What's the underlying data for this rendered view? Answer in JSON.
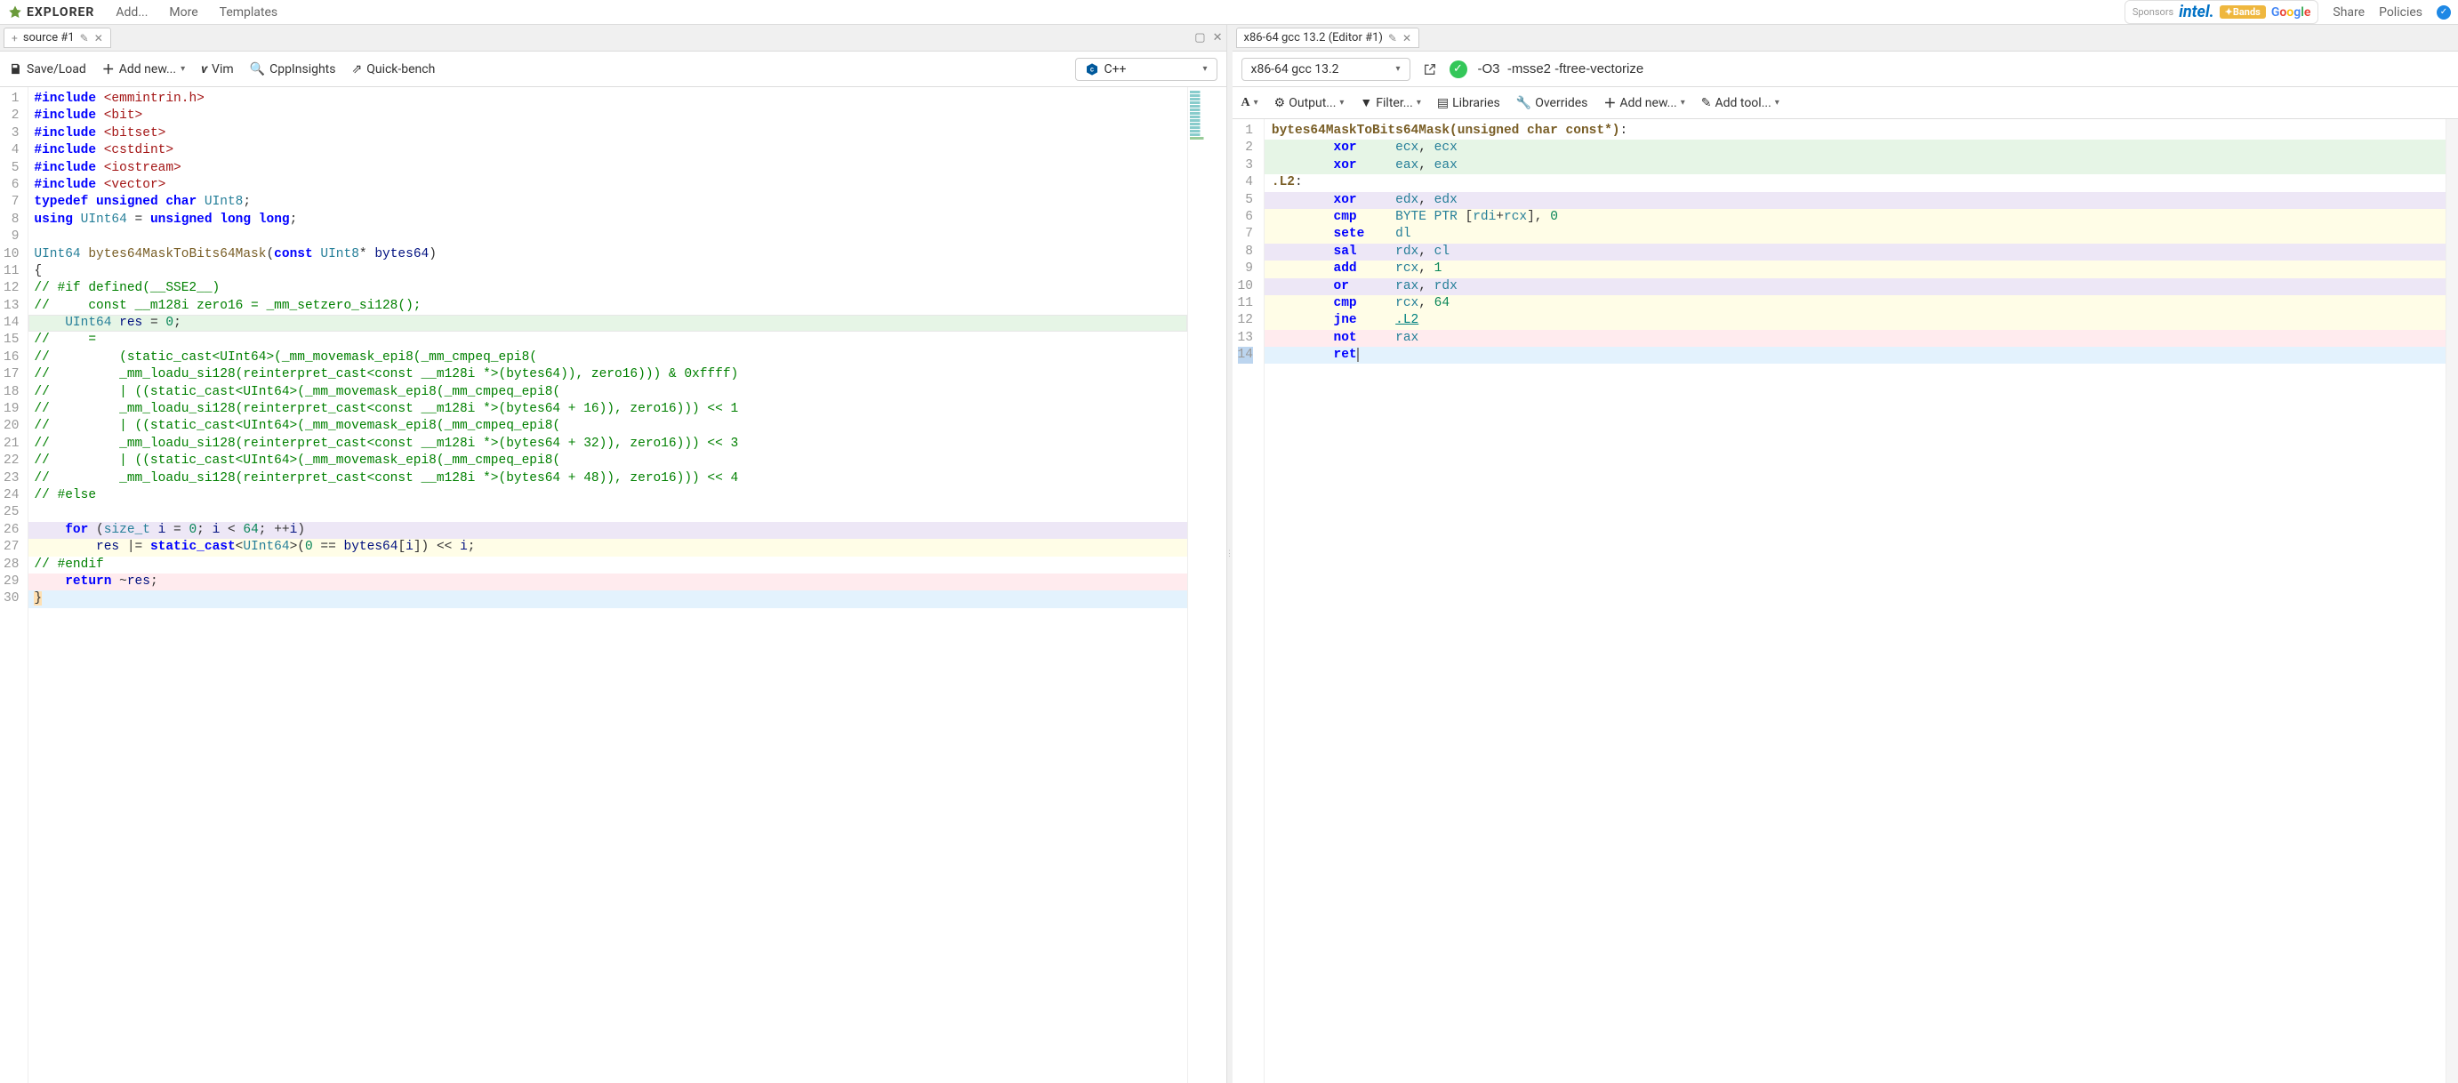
{
  "brand": "EXPLORER",
  "top_links": [
    "Add...",
    "More",
    "Templates"
  ],
  "top_right": {
    "sponsors_label": "Sponsors",
    "share": "Share",
    "policies": "Policies"
  },
  "left": {
    "tab_label": "source #1",
    "toolbar": {
      "save": "Save/Load",
      "addnew": "Add new...",
      "vim": "Vim",
      "cpp": "CppInsights",
      "quick": "Quick-bench"
    },
    "language": "C++",
    "lines": [
      {
        "n": 1,
        "bg": "",
        "html": "<span class='kw'>#include</span> <span class='inc'>&lt;emmintrin.h&gt;</span>"
      },
      {
        "n": 2,
        "bg": "",
        "html": "<span class='kw'>#include</span> <span class='inc'>&lt;bit&gt;</span>"
      },
      {
        "n": 3,
        "bg": "",
        "html": "<span class='kw'>#include</span> <span class='inc'>&lt;bitset&gt;</span>"
      },
      {
        "n": 4,
        "bg": "",
        "html": "<span class='kw'>#include</span> <span class='inc'>&lt;cstdint&gt;</span>"
      },
      {
        "n": 5,
        "bg": "",
        "html": "<span class='kw'>#include</span> <span class='inc'>&lt;iostream&gt;</span>"
      },
      {
        "n": 6,
        "bg": "",
        "html": "<span class='kw'>#include</span> <span class='inc'>&lt;vector&gt;</span>"
      },
      {
        "n": 7,
        "bg": "",
        "html": "<span class='kw'>typedef</span> <span class='kw'>unsigned</span> <span class='kw'>char</span> <span class='type'>UInt8</span>;"
      },
      {
        "n": 8,
        "bg": "",
        "html": "<span class='kw'>using</span> <span class='type'>UInt64</span> = <span class='kw'>unsigned</span> <span class='kw'>long</span> <span class='kw'>long</span>;"
      },
      {
        "n": 9,
        "bg": "",
        "html": ""
      },
      {
        "n": 10,
        "bg": "",
        "html": "<span class='type'>UInt64</span> <span class='fn'>bytes64MaskToBits64Mask</span>(<span class='kw'>const</span> <span class='type'>UInt8</span>* <span class='var'>bytes64</span>)"
      },
      {
        "n": 11,
        "bg": "",
        "html": "{"
      },
      {
        "n": 12,
        "bg": "",
        "html": "<span class='com'>// #if defined(__SSE2__)</span>"
      },
      {
        "n": 13,
        "bg": "",
        "html": "<span class='com'>//     const __m128i zero16 = _mm_setzero_si128();</span>"
      },
      {
        "n": 14,
        "bg": "bg-green hl-current",
        "html": "    <span class='type'>UInt64</span> <span class='var'>res</span> = <span class='num'>0</span>;"
      },
      {
        "n": 15,
        "bg": "",
        "html": "<span class='com'>//     =</span>"
      },
      {
        "n": 16,
        "bg": "",
        "html": "<span class='com'>//         (static_cast&lt;UInt64&gt;(_mm_movemask_epi8(_mm_cmpeq_epi8(</span>"
      },
      {
        "n": 17,
        "bg": "",
        "html": "<span class='com'>//         _mm_loadu_si128(reinterpret_cast&lt;const __m128i *&gt;(bytes64)), zero16))) &amp; 0xffff)</span>"
      },
      {
        "n": 18,
        "bg": "",
        "html": "<span class='com'>//         | ((static_cast&lt;UInt64&gt;(_mm_movemask_epi8(_mm_cmpeq_epi8(</span>"
      },
      {
        "n": 19,
        "bg": "",
        "html": "<span class='com'>//         _mm_loadu_si128(reinterpret_cast&lt;const __m128i *&gt;(bytes64 + 16)), zero16))) &lt;&lt; 1</span>"
      },
      {
        "n": 20,
        "bg": "",
        "html": "<span class='com'>//         | ((static_cast&lt;UInt64&gt;(_mm_movemask_epi8(_mm_cmpeq_epi8(</span>"
      },
      {
        "n": 21,
        "bg": "",
        "html": "<span class='com'>//         _mm_loadu_si128(reinterpret_cast&lt;const __m128i *&gt;(bytes64 + 32)), zero16))) &lt;&lt; 3</span>"
      },
      {
        "n": 22,
        "bg": "",
        "html": "<span class='com'>//         | ((static_cast&lt;UInt64&gt;(_mm_movemask_epi8(_mm_cmpeq_epi8(</span>"
      },
      {
        "n": 23,
        "bg": "",
        "html": "<span class='com'>//         _mm_loadu_si128(reinterpret_cast&lt;const __m128i *&gt;(bytes64 + 48)), zero16))) &lt;&lt; 4</span>"
      },
      {
        "n": 24,
        "bg": "",
        "html": "<span class='com'>// #else</span>"
      },
      {
        "n": 25,
        "bg": "",
        "html": ""
      },
      {
        "n": 26,
        "bg": "bg-purple",
        "html": "    <span class='kw'>for</span> (<span class='type'>size_t</span> <span class='var'>i</span> = <span class='num'>0</span>; <span class='var'>i</span> &lt; <span class='num'>64</span>; ++<span class='var'>i</span>)"
      },
      {
        "n": 27,
        "bg": "bg-yellow",
        "html": "        <span class='var'>res</span> |= <span class='kw'>static_cast</span>&lt;<span class='type'>UInt64</span>&gt;(<span class='num'>0</span> == <span class='var'>bytes64</span>[<span class='var'>i</span>]) &lt;&lt; <span class='var'>i</span>;"
      },
      {
        "n": 28,
        "bg": "",
        "html": "<span class='com'>// #endif</span>"
      },
      {
        "n": 29,
        "bg": "bg-red",
        "html": "    <span class='kw'>return</span> ~<span class='var'>res</span>;"
      },
      {
        "n": 30,
        "bg": "bg-blue",
        "html": "<span style='background:#ffe0b2'>}</span>"
      }
    ]
  },
  "right": {
    "tab_label": "x86-64 gcc 13.2 (Editor #1)",
    "compiler": "x86-64 gcc 13.2",
    "flags": "-O3  -msse2 -ftree-vectorize",
    "toolbar": {
      "font": "A",
      "output": "Output...",
      "filter": "Filter...",
      "libraries": "Libraries",
      "overrides": "Overrides",
      "addnew": "Add new...",
      "addtool": "Add tool..."
    },
    "asm": [
      {
        "n": 1,
        "bg": "",
        "html": "<span class='alabel'>bytes64MaskToBits64Mask(unsigned char const*)</span>:"
      },
      {
        "n": 2,
        "bg": "bg-green",
        "html": "        <span class='akw'>xor</span>     <span class='areg'>ecx</span>, <span class='areg'>ecx</span>"
      },
      {
        "n": 3,
        "bg": "bg-green",
        "html": "        <span class='akw'>xor</span>     <span class='areg'>eax</span>, <span class='areg'>eax</span>"
      },
      {
        "n": 4,
        "bg": "",
        "html": "<span class='alabel'>.L2</span>:"
      },
      {
        "n": 5,
        "bg": "bg-purple",
        "html": "        <span class='akw'>xor</span>     <span class='areg'>edx</span>, <span class='areg'>edx</span>"
      },
      {
        "n": 6,
        "bg": "bg-yellow",
        "html": "        <span class='akw'>cmp</span>     <span class='adir'>BYTE</span> <span class='adir'>PTR</span> [<span class='areg'>rdi</span>+<span class='areg'>rcx</span>], <span class='anum'>0</span>"
      },
      {
        "n": 7,
        "bg": "bg-yellow",
        "html": "        <span class='akw'>sete</span>    <span class='areg'>dl</span>"
      },
      {
        "n": 8,
        "bg": "bg-purple",
        "html": "        <span class='akw'>sal</span>     <span class='areg'>rdx</span>, <span class='areg'>cl</span>"
      },
      {
        "n": 9,
        "bg": "bg-yellow",
        "html": "        <span class='akw'>add</span>     <span class='areg'>rcx</span>, <span class='anum'>1</span>"
      },
      {
        "n": 10,
        "bg": "bg-purple",
        "html": "        <span class='akw'>or</span>      <span class='areg'>rax</span>, <span class='areg'>rdx</span>"
      },
      {
        "n": 11,
        "bg": "bg-yellow",
        "html": "        <span class='akw'>cmp</span>     <span class='areg'>rcx</span>, <span class='anum'>64</span>"
      },
      {
        "n": 12,
        "bg": "bg-yellow",
        "html": "        <span class='akw'>jne</span>     <span class='alabel-ref'>.L2</span>"
      },
      {
        "n": 13,
        "bg": "bg-red",
        "html": "        <span class='akw'>not</span>     <span class='areg'>rax</span>"
      },
      {
        "n": 14,
        "bg": "bg-blue",
        "hl": true,
        "html": "        <span class='akw'>ret</span><span class='cursor-box'></span>"
      }
    ]
  }
}
